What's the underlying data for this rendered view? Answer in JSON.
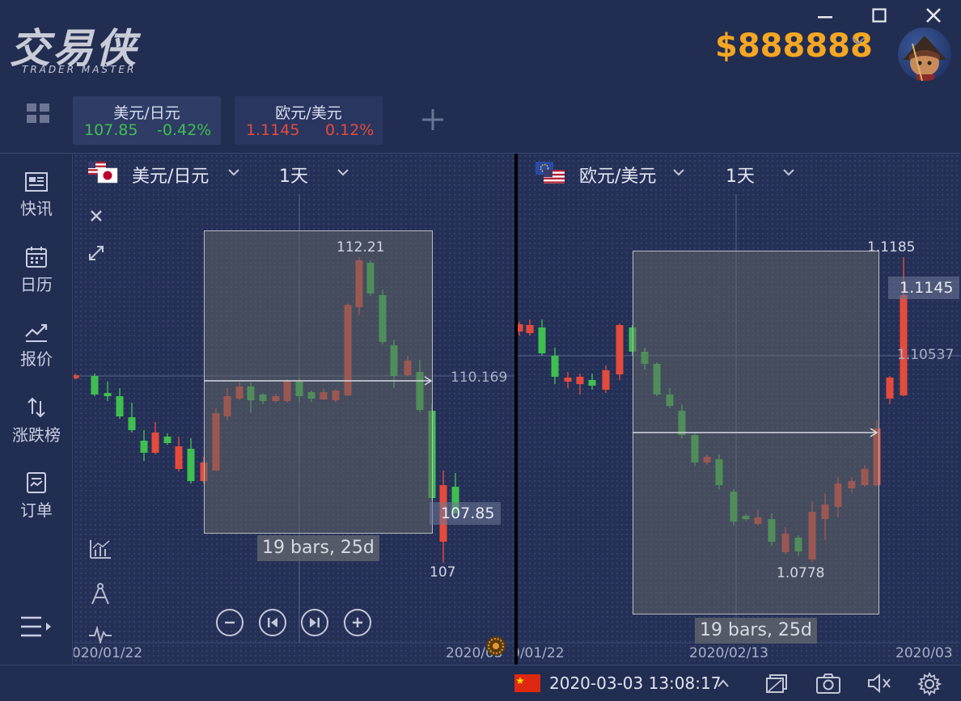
{
  "app": {
    "logo_text": "交易侠",
    "logo_subtitle": "TRADER MASTER",
    "balance": "$888888"
  },
  "tickers": [
    {
      "symbol": "美元/日元",
      "price": "107.85",
      "change": "-0.42%",
      "price_color": "#3fbf4f",
      "change_color": "#3fbf4f"
    },
    {
      "symbol": "欧元/美元",
      "price": "1.1145",
      "change": "0.12%",
      "price_color": "#e54b3c",
      "change_color": "#e54b3c"
    }
  ],
  "sidebar": {
    "items": [
      {
        "label": "快讯",
        "icon": "news-icon"
      },
      {
        "label": "日历",
        "icon": "calendar-icon"
      },
      {
        "label": "报价",
        "icon": "quote-chart-icon"
      },
      {
        "label": "涨跌榜",
        "icon": "up-down-arrows-icon"
      },
      {
        "label": "订单",
        "icon": "order-icon"
      }
    ]
  },
  "left_chart": {
    "symbol": "美元/日元",
    "timeframe": "1天",
    "high_label": "112.21",
    "low_label": "107",
    "crosshair_value": "110.169",
    "current_price": "107.85",
    "range_label": "19 bars, 25d",
    "x_tick_1": "020/01/22",
    "x_tick_2": "2020/03"
  },
  "right_chart": {
    "symbol": "欧元/美元",
    "timeframe": "1天",
    "high_label": "1.1185",
    "low_label": "1.0778",
    "crosshair_value": "1.10537",
    "current_price": "1.1145",
    "range_label": "19 bars, 25d",
    "x_tick_1": "0/01/22",
    "x_tick_2": "2020/02/13",
    "x_tick_3": "2020/03"
  },
  "statusbar": {
    "datetime": "2020-03-03 13:08:17"
  },
  "colors": {
    "up": "#3fbf4f",
    "down": "#e54b3c",
    "accent": "#f5a623",
    "background": "#1f2a4d"
  }
}
